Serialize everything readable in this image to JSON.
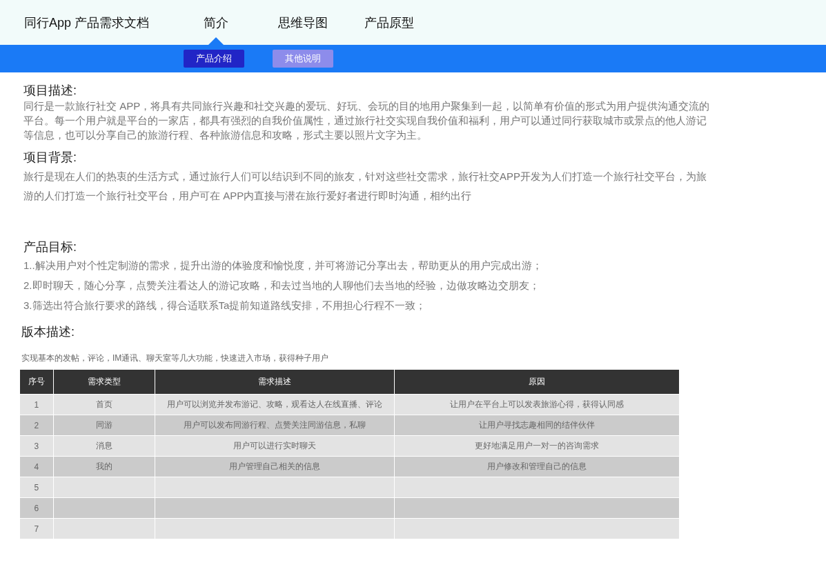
{
  "header": {
    "title": "同行App 产品需求文档",
    "nav": [
      {
        "label": "简介",
        "selected": true
      },
      {
        "label": "思维导图",
        "selected": false
      },
      {
        "label": "产品原型",
        "selected": false
      }
    ]
  },
  "sub_tabs": [
    {
      "label": "产品介绍",
      "selected": true
    },
    {
      "label": "其他说明",
      "selected": false
    }
  ],
  "sections": [
    {
      "heading": "项目描述:",
      "paragraphs": [
        "同行是一款旅行社交 APP，将具有共同旅行兴趣和社交兴趣的爱玩、好玩、会玩的目的地用户聚集到一起，以简单有价值的形式为用户提供沟通交流的平台。每一个用户就是平台的一家店，都具有强烈的自我价值属性，通过旅行社交实现自我价值和福利，用户可以通过同行获取城市或景点的他人游记等信息，也可以分享自己的旅游行程、各种旅游信息和攻略，形式主要以照片文字为主。"
      ]
    },
    {
      "heading": "项目背景:",
      "paragraphs": [
        "旅行是现在人们的热衷的生活方式，通过旅行人们可以结识到不同的旅友，针对这些社交需求，旅行社交APP开发为人们打造一个旅行社交平台，为旅游的人们打造一个旅行社交平台，用户可在 APP内直接与潜在旅行爱好者进行即时沟通，相约出行"
      ]
    },
    {
      "heading": "产品目标:",
      "paragraphs": [
        "1..解决用户对个性定制游的需求，提升出游的体验度和愉悦度，并可将游记分享出去，帮助更从的用户完成出游；",
        "2.即时聊天，随心分享，点赞关注看达人的游记攻略，和去过当地的人聊他们去当地的经验，边做攻略边交朋友；",
        "3.筛选出符合旅行要求的路线，得合适联系Ta提前知道路线安排，不用担心行程不一致；"
      ]
    }
  ],
  "version": {
    "heading": "版本描述:",
    "note": "实现基本的发帖，评论，IM通讯、聊天室等几大功能，快速进入市场，获得种子用户"
  },
  "table": {
    "columns": [
      "序号",
      "需求类型",
      "需求描述",
      "原因"
    ],
    "rows": [
      {
        "cells": [
          "1",
          "首页",
          "用户可以浏览并发布游记、攻略，观看达人在线直播、评论",
          "让用户在平台上可以发表旅游心得，获得认同感"
        ]
      },
      {
        "cells": [
          "2",
          "同游",
          "用户可以发布同游行程、点赞关注同游信息，私聊",
          "让用户寻找志趣相同的结伴伙伴"
        ]
      },
      {
        "cells": [
          "3",
          "消息",
          "用户可以进行实时聊天",
          "更好地满足用户一对一的咨询需求"
        ]
      },
      {
        "cells": [
          "4",
          "我的",
          "用户管理自己相关的信息",
          "用户修改和管理自己的信息"
        ]
      },
      {
        "cells": [
          "5"
        ]
      },
      {
        "cells": [
          "6"
        ]
      },
      {
        "cells": [
          "7"
        ]
      }
    ]
  }
}
